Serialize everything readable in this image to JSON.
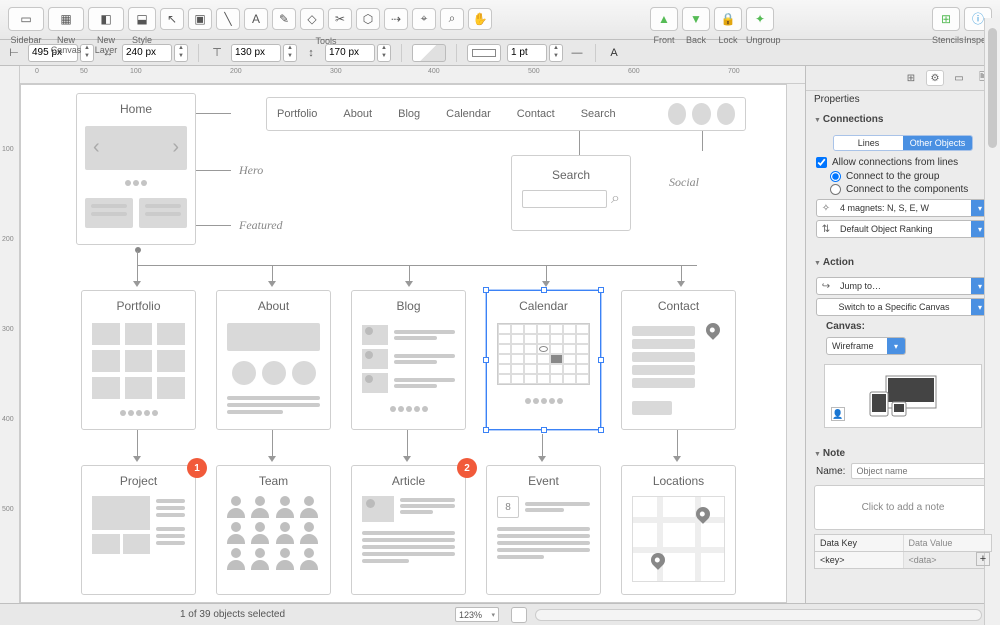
{
  "toolbar": {
    "sidebar": "Sidebar",
    "newcanvas": "New Canvas",
    "newlayer": "New Layer",
    "style": "Style",
    "tools": "Tools",
    "front": "Front",
    "back": "Back",
    "lock": "Lock",
    "ungroup": "Ungroup",
    "stencils": "Stencils",
    "inspect": "Inspect"
  },
  "optbar": {
    "x": "495 px",
    "w": "240 px",
    "y": "130 px",
    "h": "170 px",
    "stroke": "1 pt"
  },
  "ruler_h": [
    "0",
    "50",
    "100",
    "200",
    "300",
    "400",
    "500",
    "600",
    "700"
  ],
  "ruler_v": [
    "100",
    "200",
    "300",
    "400",
    "500"
  ],
  "canvas": {
    "home": "Home",
    "hero": "Hero",
    "featured": "Featured",
    "social": "Social",
    "nav": [
      "Portfolio",
      "About",
      "Blog",
      "Calendar",
      "Contact",
      "Search"
    ],
    "searchbox": "Search",
    "cards_row1": [
      "Portfolio",
      "About",
      "Blog",
      "Calendar",
      "Contact"
    ],
    "cards_row2": [
      "Project",
      "Team",
      "Article",
      "Event",
      "Locations"
    ],
    "event_day": "8",
    "badge1": "1",
    "badge2": "2"
  },
  "props": {
    "header": "Properties",
    "connections": "Connections",
    "seg_lines": "Lines",
    "seg_other": "Other Objects",
    "allow": "Allow connections from lines",
    "cgroup": "Connect to the group",
    "ccomp": "Connect to the components",
    "magnets": "4 magnets: N, S, E, W",
    "ranking": "Default Object Ranking",
    "action": "Action",
    "jumpto": "Jump to…",
    "switchto": "Switch to a Specific Canvas",
    "canvas_lbl": "Canvas:",
    "canvas_val": "Wireframe",
    "note": "Note",
    "name_lbl": "Name:",
    "name_ph": "Object name",
    "note_ph": "Click to add a note",
    "datakey": "Data Key",
    "dataval": "Data Value",
    "keyph": "<key>",
    "valph": "<data>"
  },
  "status": {
    "selection": "1 of 39 objects selected",
    "zoom": "123%"
  }
}
